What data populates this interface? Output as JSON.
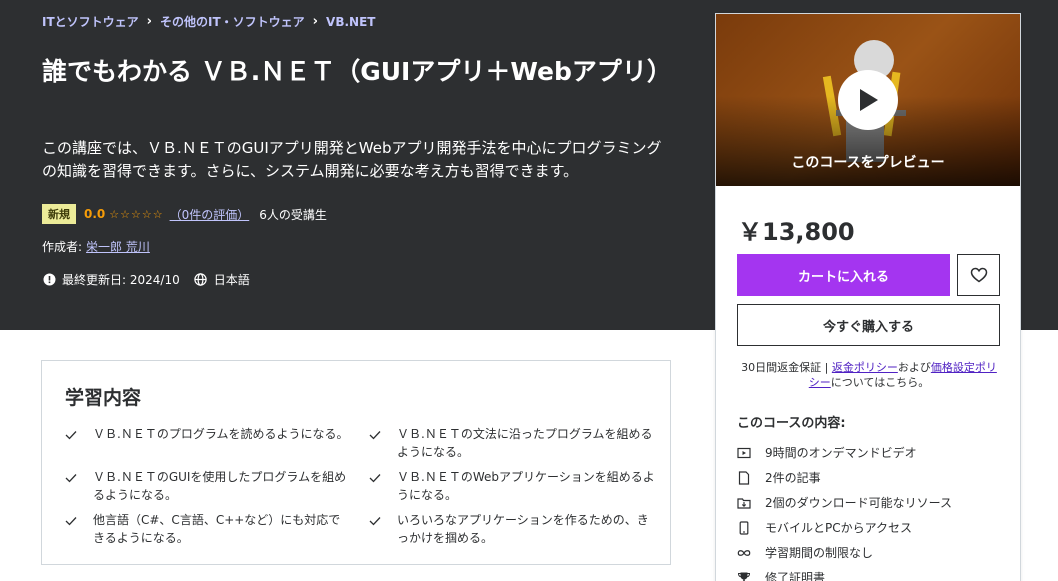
{
  "breadcrumb": [
    "ITとソフトウェア",
    "その他のIT・ソフトウェア",
    "VB.NET"
  ],
  "course": {
    "title": "誰でもわかる ＶＢ.ＮＥＴ（GUIアプリ＋Webアプリ）",
    "subtitle": "この講座では、ＶＢ.ＮＥＴのGUIアプリ開発とWebアプリ開発手法を中心にプログラミングの知識を習得できます。さらに、システム開発に必要な考え方も習得できます。",
    "badge": "新規",
    "rating": "0.0",
    "stars": "☆☆☆☆☆",
    "rating_count": "（0件の評価）",
    "students": "6人の受講生",
    "author_label": "作成者:",
    "author": "栄一郎 荒川",
    "updated": "最終更新日: 2024/10",
    "language": "日本語"
  },
  "sidebar": {
    "preview_label": "このコースをプレビュー",
    "price": "￥13,800",
    "cart_button": "カートに入れる",
    "buy_button": "今すぐ購入する",
    "guarantee": {
      "prefix": "30日間返金保証 | ",
      "refund_link": "返金ポリシー",
      "mid": "および",
      "pricing_link": "価格設定ポリシー",
      "suffix": "についてはこちら。"
    },
    "includes_title": "このコースの内容:",
    "includes": [
      {
        "icon": "video-icon",
        "label": "9時間のオンデマンドビデオ"
      },
      {
        "icon": "file-icon",
        "label": "2件の記事"
      },
      {
        "icon": "download-folder-icon",
        "label": "2個のダウンロード可能なリソース"
      },
      {
        "icon": "mobile-icon",
        "label": "モバイルとPCからアクセス"
      },
      {
        "icon": "infinity-icon",
        "label": "学習期間の制限なし"
      },
      {
        "icon": "trophy-icon",
        "label": "修了証明書"
      }
    ]
  },
  "learn": {
    "title": "学習内容",
    "items": [
      "ＶＢ.ＮＥＴのプログラムを読めるようになる。",
      "ＶＢ.ＮＥＴの文法に沿ったプログラムを組めるようになる。",
      "ＶＢ.ＮＥＴのGUIを使用したプログラムを組めるようになる。",
      "ＶＢ.ＮＥＴのWebアプリケーションを組めるようになる。",
      "他言語（C#、C言語、C++など）にも対応できるようになる。",
      "いろいろなアプリケーションを作るための、きっかけを掴める。"
    ]
  },
  "colors": {
    "hero_bg": "#2d2f31",
    "accent": "#a435f0",
    "link": "#c0c4fc",
    "star": "#f69c08",
    "badge_bg": "#eceb98"
  }
}
